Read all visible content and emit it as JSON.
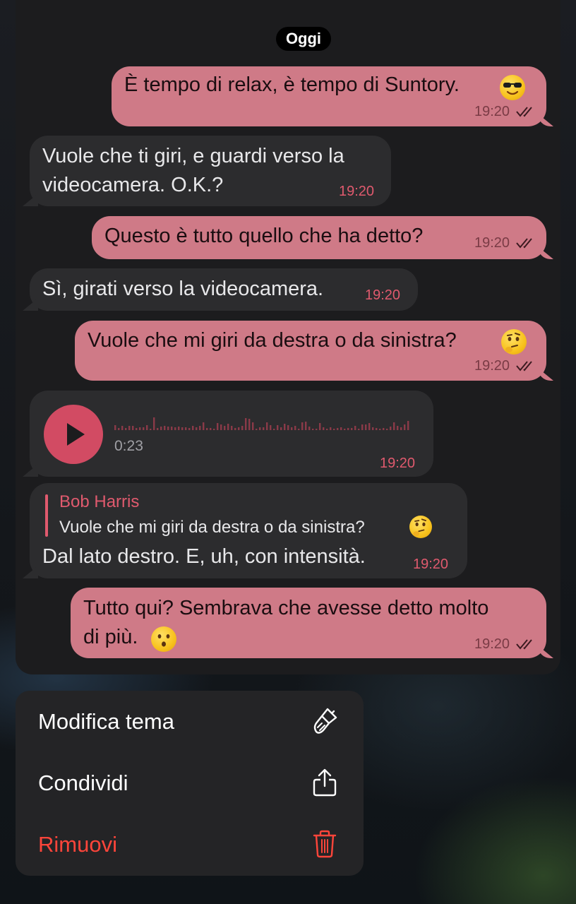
{
  "chat": {
    "date_label": "Oggi",
    "messages": [
      {
        "type": "outgoing",
        "text": "È tempo di relax, è tempo di Suntory.",
        "emoji": "smiling-face-with-sunglasses",
        "time": "19:20",
        "status": "read"
      },
      {
        "type": "incoming",
        "lines": [
          "Vuole che ti giri, e guardi verso la",
          "videocamera. O.K.?"
        ],
        "time": "19:20"
      },
      {
        "type": "outgoing",
        "text": "Questo è tutto quello che ha detto?",
        "time": "19:20",
        "status": "read"
      },
      {
        "type": "incoming",
        "text": "Sì, girati verso la videocamera.",
        "time": "19:20"
      },
      {
        "type": "outgoing",
        "text": "Vuole che mi giri da destra o da sinistra?",
        "emoji": "thinking-face",
        "time": "19:20",
        "status": "read"
      },
      {
        "type": "voice",
        "duration": "0:23",
        "time": "19:20"
      },
      {
        "type": "incoming_reply",
        "reply_author": "Bob Harris",
        "reply_text": "Vuole che mi giri da destra o da sinistra?",
        "reply_emoji": "thinking-face",
        "text": "Dal lato destro. E, uh, con intensità.",
        "time": "19:20"
      },
      {
        "type": "outgoing",
        "lines": [
          "Tutto qui? Sembrava che avesse detto molto",
          "di più."
        ],
        "emoji": "hushed-face",
        "time": "19:20",
        "status": "read"
      }
    ]
  },
  "menu": {
    "items": [
      {
        "label": "Modifica tema",
        "icon": "brush-icon"
      },
      {
        "label": "Condividi",
        "icon": "share-icon"
      },
      {
        "label": "Rimuovi",
        "icon": "trash-icon",
        "destructive": true
      }
    ]
  },
  "colors": {
    "outgoing_bubble": "#cf7a87",
    "incoming_bubble": "#2c2c2e",
    "accent": "#e05a6e",
    "destructive": "#ff453a"
  }
}
